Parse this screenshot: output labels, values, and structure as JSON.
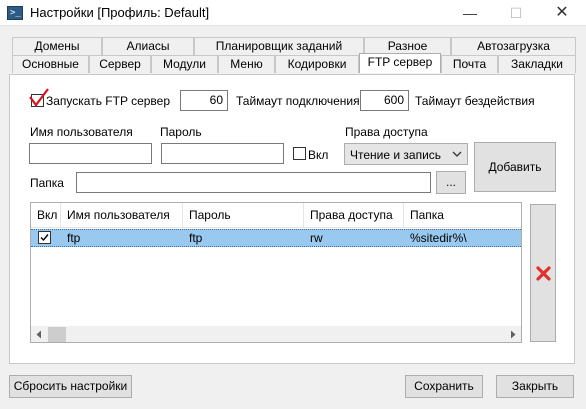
{
  "window": {
    "title": "Настройки [Профиль: Default]",
    "controls": {
      "minimize": "—",
      "maximize": "☐",
      "close": "✕"
    }
  },
  "tabs": {
    "row1": [
      "Домены",
      "Алиасы",
      "Планировщик заданий",
      "Разное",
      "Автозагрузка"
    ],
    "row2": [
      "Основные",
      "Сервер",
      "Модули",
      "Меню",
      "Кодировки",
      "FTP сервер",
      "Почта",
      "Закладки"
    ],
    "active": "FTP сервер"
  },
  "ftp": {
    "run_label": "Запускать FTP сервер",
    "run_checked": true,
    "connect_timeout_value": "60",
    "connect_timeout_label": "Таймаут подключения",
    "idle_timeout_value": "600",
    "idle_timeout_label": "Таймаут бездействия",
    "username_label": "Имя пользователя",
    "username_value": "",
    "password_label": "Пароль",
    "password_value": "",
    "enabled_label": "Вкл",
    "enabled_checked": false,
    "access_label": "Права доступа",
    "access_value": "Чтение и запись",
    "add_button": "Добавить",
    "folder_label": "Папка",
    "folder_value": "",
    "browse_button": "...",
    "table": {
      "columns": [
        "Вкл",
        "Имя пользователя",
        "Пароль",
        "Права доступа",
        "Папка"
      ],
      "rows": [
        {
          "enabled": true,
          "username": "ftp",
          "password": "ftp",
          "access": "rw",
          "folder": "%sitedir%\\"
        }
      ]
    },
    "delete_icon": "red-x-icon"
  },
  "footer": {
    "reset_button": "Сбросить настройки",
    "save_button": "Сохранить",
    "close_button": "Закрыть"
  },
  "colors": {
    "selection": "#99c9ef",
    "delete_icon": "#e0312b",
    "check_mark": "#d8141a"
  }
}
